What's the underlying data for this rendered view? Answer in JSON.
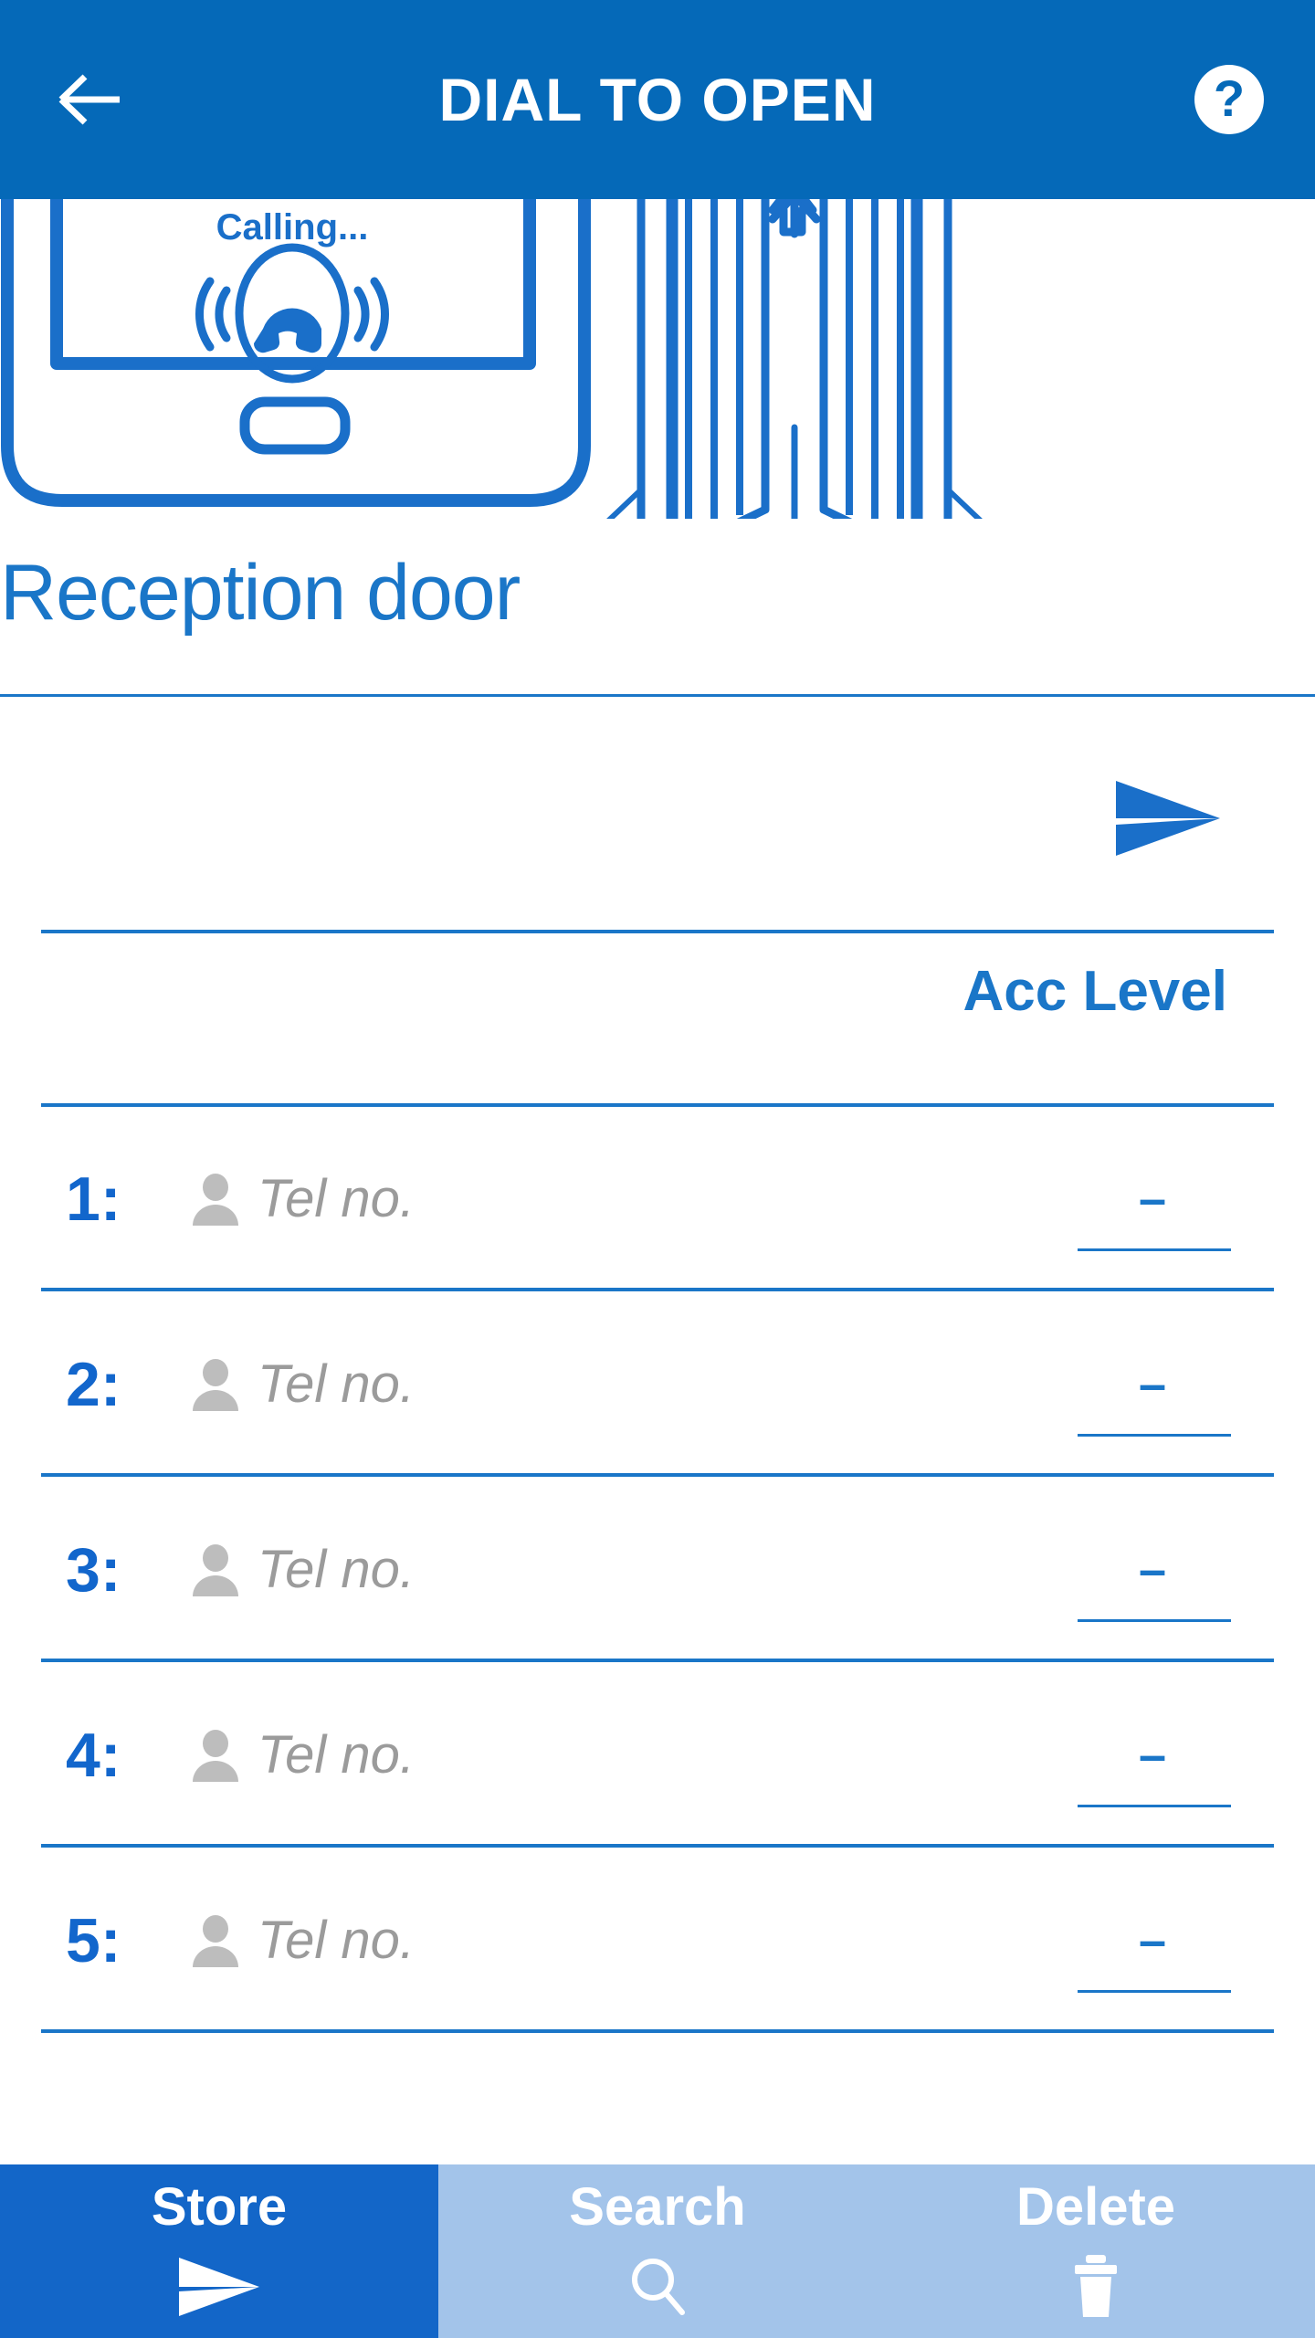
{
  "header": {
    "title": "DIAL TO OPEN",
    "back_icon": "arrow-left-icon",
    "help_icon": "help-circle-icon",
    "help_glyph": "?",
    "bg_color": "#0569B8"
  },
  "illustration": {
    "phone_screen_text": "Calling...",
    "phone_icon": "ringing-handset-icon",
    "gate_icon": "opening-gate-icon",
    "stroke_color": "#1A6FC9"
  },
  "door": {
    "title": "Reception door"
  },
  "name_field": {
    "value": "",
    "placeholder": "",
    "send_icon": "send-arrow-icon"
  },
  "table": {
    "acc_level_header": "Acc Level",
    "rows": [
      {
        "index": "1:",
        "person_icon": "person-icon",
        "tel_value": "",
        "tel_placeholder": "Tel no.",
        "acc_level": "–"
      },
      {
        "index": "2:",
        "person_icon": "person-icon",
        "tel_value": "",
        "tel_placeholder": "Tel no.",
        "acc_level": "–"
      },
      {
        "index": "3:",
        "person_icon": "person-icon",
        "tel_value": "",
        "tel_placeholder": "Tel no.",
        "acc_level": "–"
      },
      {
        "index": "4:",
        "person_icon": "person-icon",
        "tel_value": "",
        "tel_placeholder": "Tel no.",
        "acc_level": "–"
      },
      {
        "index": "5:",
        "person_icon": "person-icon",
        "tel_value": "",
        "tel_placeholder": "Tel no.",
        "acc_level": "–"
      }
    ]
  },
  "bottom_bar": {
    "buttons": [
      {
        "label": "Store",
        "icon": "send-arrow-icon",
        "active": true,
        "bg": "#1366C8"
      },
      {
        "label": "Search",
        "icon": "magnifier-icon",
        "active": false,
        "bg": "#A3C4EA"
      },
      {
        "label": "Delete",
        "icon": "trash-can-icon",
        "active": false,
        "bg": "#A3C4EA"
      }
    ]
  },
  "colors": {
    "brand_blue": "#0569B8",
    "accent_blue": "#1A76C8",
    "active_blue": "#1366C8",
    "inactive_blue": "#A3C4EA",
    "placeholder_gray": "#9b9b9b"
  }
}
